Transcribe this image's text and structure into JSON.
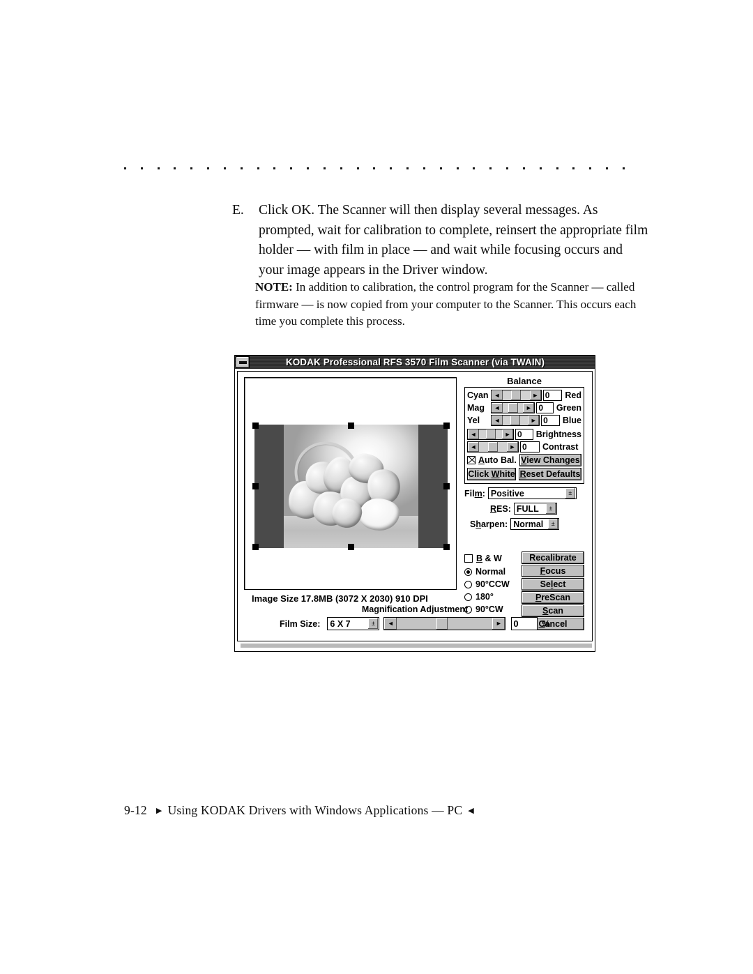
{
  "page": {
    "rule_dots": 31,
    "step": {
      "letter": "E.",
      "text": "Click OK. The Scanner will then display several messages. As prompted, wait for calibration to complete, reinsert the appropriate film holder — with film in place — and wait while focusing occurs and your image appears in the Driver window."
    },
    "note": {
      "label": "NOTE:",
      "text": " In addition to calibration, the control program for the Scanner — called firmware — is now copied from your computer to the Scanner. This occurs each time you complete this process."
    },
    "footer": {
      "page_number": "9-12",
      "left_triangle": "▶",
      "title": "Using KODAK Drivers with Windows Applications — PC",
      "right_triangle": "◀"
    }
  },
  "dialog": {
    "title": "KODAK Professional RFS 3570 Film Scanner (via TWAIN)",
    "minimize_icon": "minimize-icon",
    "image_size_text": "Image Size  17.8MB (3072 X 2030) 910 DPI",
    "balance": {
      "group_title": "Balance",
      "rows": [
        {
          "left_label": "Cyan",
          "value": "0",
          "right_label": "Red"
        },
        {
          "left_label": "Mag",
          "value": "0",
          "right_label": "Green"
        },
        {
          "left_label": "Yel",
          "value": "0",
          "right_label": "Blue"
        }
      ],
      "sliders": [
        {
          "value": "0",
          "label": "Brightness"
        },
        {
          "value": "0",
          "label": "Contrast"
        }
      ],
      "auto_bal": {
        "label": "Auto Bal.",
        "checked": true
      },
      "view_changes": "View Changes",
      "click_white": "Click White",
      "reset_defaults": "Reset Defaults"
    },
    "selects": [
      {
        "label": "Film:",
        "value": "Positive"
      },
      {
        "label": "RES:",
        "value": "FULL"
      },
      {
        "label": "Sharpen:",
        "value": "Normal"
      }
    ],
    "bw_checkbox": {
      "label": "B & W",
      "checked": false
    },
    "orientation": {
      "options": [
        "Normal",
        "90°CCW",
        "180°",
        "90°CW"
      ],
      "selected": "Normal"
    },
    "action_buttons": [
      "Recalibrate",
      "Focus",
      "Select",
      "PreScan",
      "Scan",
      "Cancel"
    ],
    "magnification": {
      "title": "Magnification Adjustment",
      "film_size_label": "Film Size:",
      "film_size_value": "6 X 7",
      "value": "0",
      "unit": "%"
    },
    "arrow_left_glyph": "◄",
    "arrow_right_glyph": "►",
    "drop_glyph": "±",
    "colors": {
      "face": "#c0c0c0",
      "titlebar": "#303030",
      "text": "#000000"
    }
  }
}
